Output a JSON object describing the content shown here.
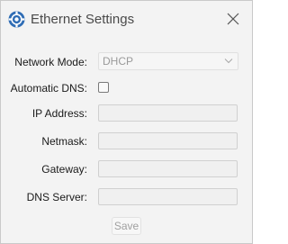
{
  "window": {
    "title": "Ethernet Settings",
    "app_icon": "gear-network-icon",
    "close_icon": "close-icon"
  },
  "form": {
    "network_mode": {
      "label": "Network Mode:",
      "value": "DHCP"
    },
    "automatic_dns": {
      "label": "Automatic DNS:",
      "checked": false
    },
    "ip_address": {
      "label": "IP Address:",
      "value": ""
    },
    "netmask": {
      "label": "Netmask:",
      "value": ""
    },
    "gateway": {
      "label": "Gateway:",
      "value": ""
    },
    "dns_server": {
      "label": "DNS Server:",
      "value": ""
    }
  },
  "actions": {
    "save_label": "Save",
    "save_enabled": false
  },
  "colors": {
    "icon_blue": "#2f6db5",
    "background": "#f3f3f3",
    "disabled_text": "#a0a0a0"
  }
}
